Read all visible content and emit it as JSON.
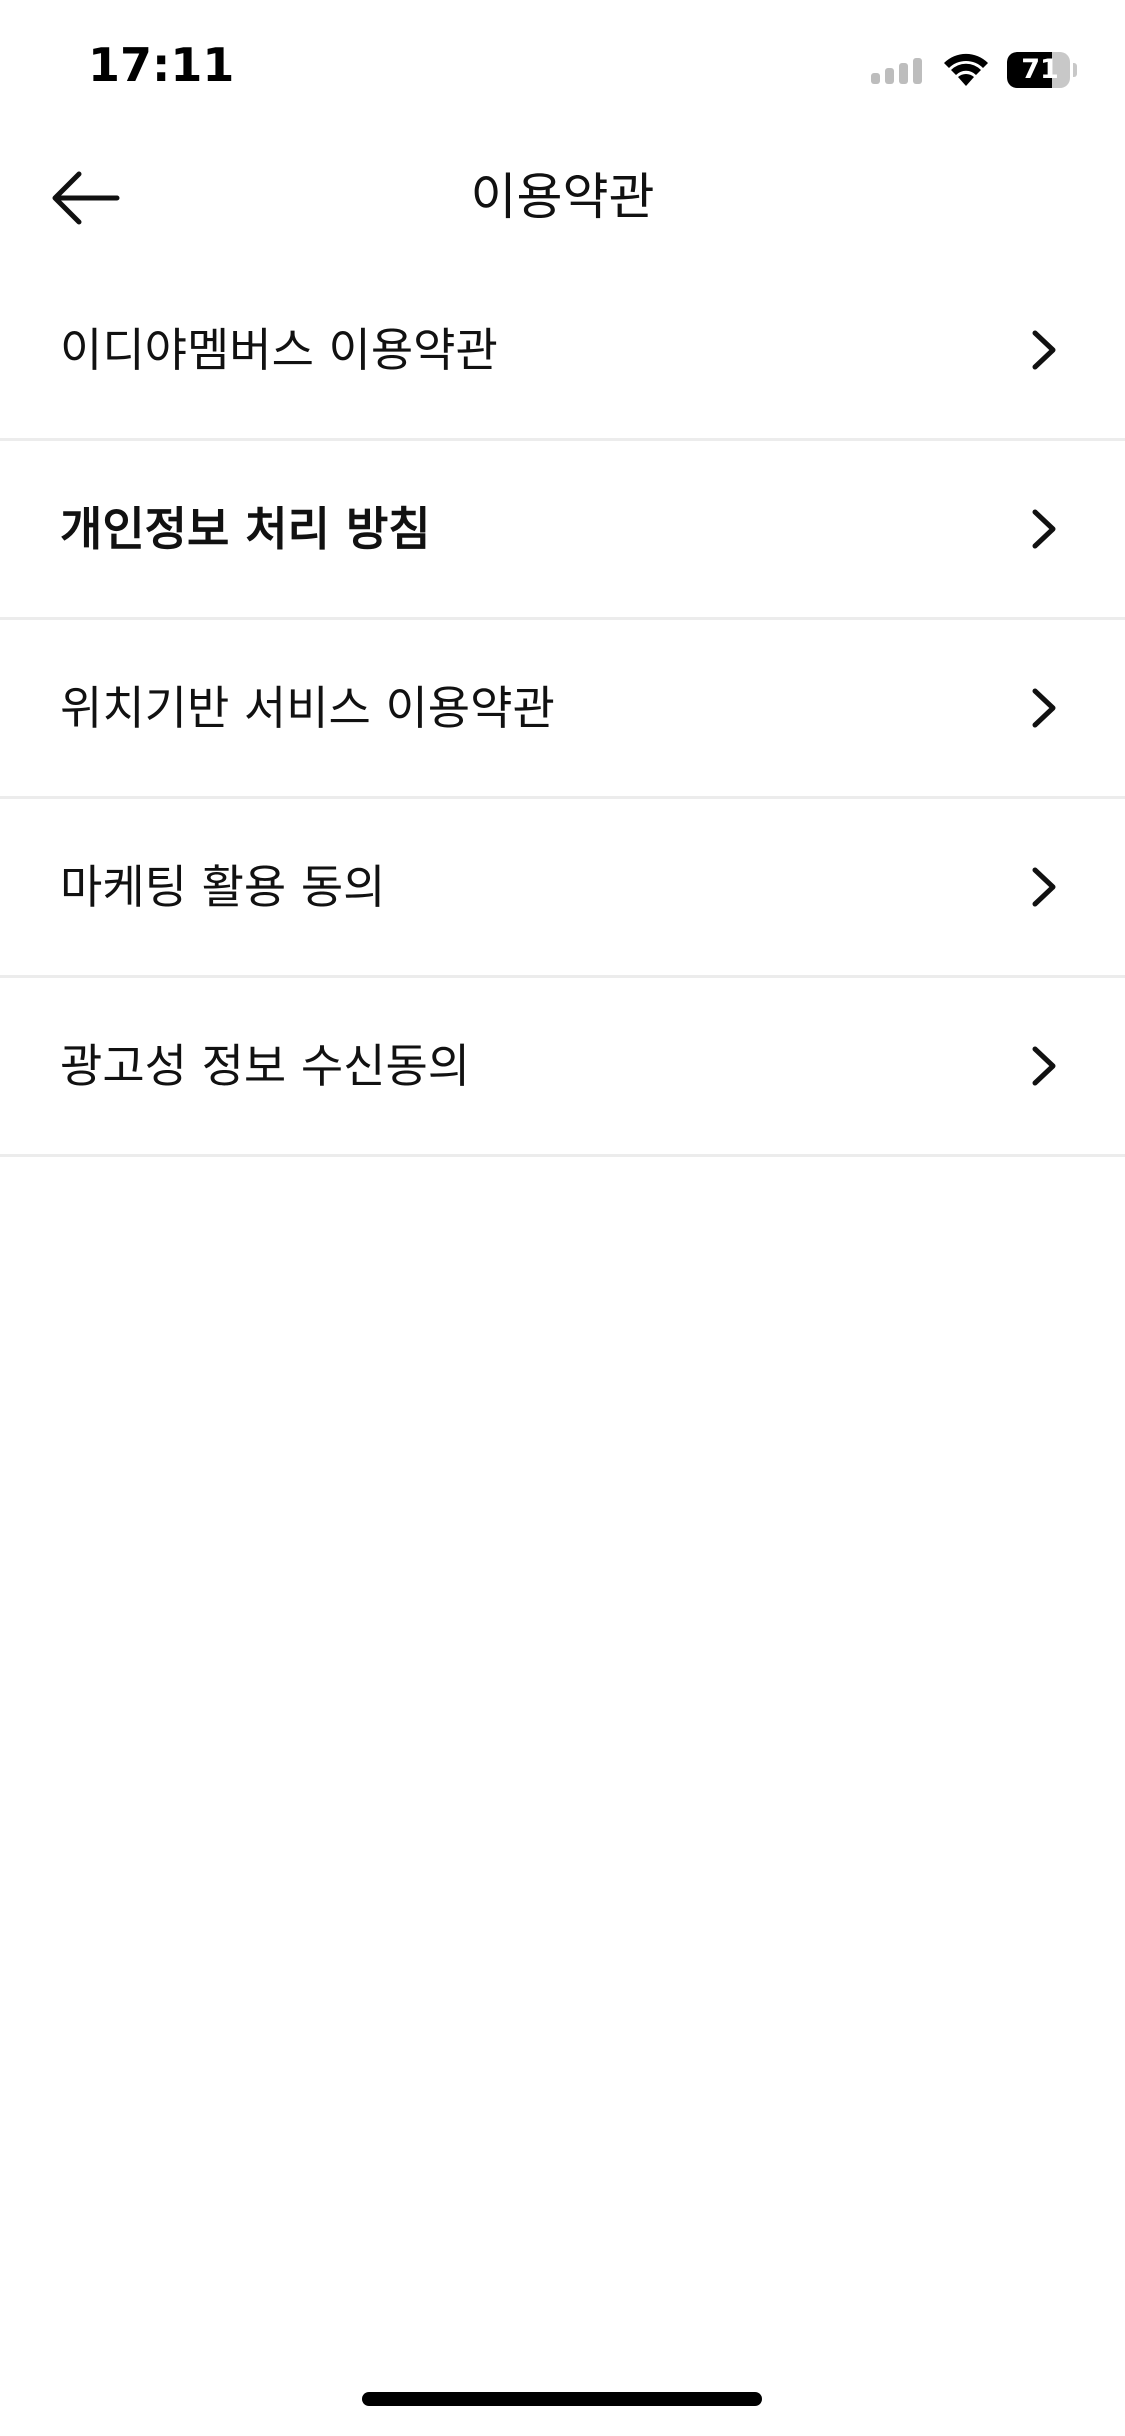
{
  "status_bar": {
    "time": "17:11",
    "battery_percent": 71,
    "battery_label": "71",
    "signal_icon": "cellular-signal-icon",
    "wifi_icon": "wifi-icon",
    "battery_icon": "battery-icon"
  },
  "header": {
    "title": "이용약관",
    "back_icon": "arrow-left-icon"
  },
  "terms": {
    "items": [
      {
        "label": "이디야멤버스 이용약관",
        "bold": false,
        "icon": "chevron-right-icon"
      },
      {
        "label": "개인정보 처리 방침",
        "bold": true,
        "icon": "chevron-right-icon"
      },
      {
        "label": "위치기반 서비스 이용약관",
        "bold": false,
        "icon": "chevron-right-icon"
      },
      {
        "label": "마케팅 활용 동의",
        "bold": false,
        "icon": "chevron-right-icon"
      },
      {
        "label": "광고성 정보 수신동의",
        "bold": false,
        "icon": "chevron-right-icon"
      }
    ]
  },
  "colors": {
    "background": "#ffffff",
    "text": "#111111",
    "divider": "#ececec"
  }
}
